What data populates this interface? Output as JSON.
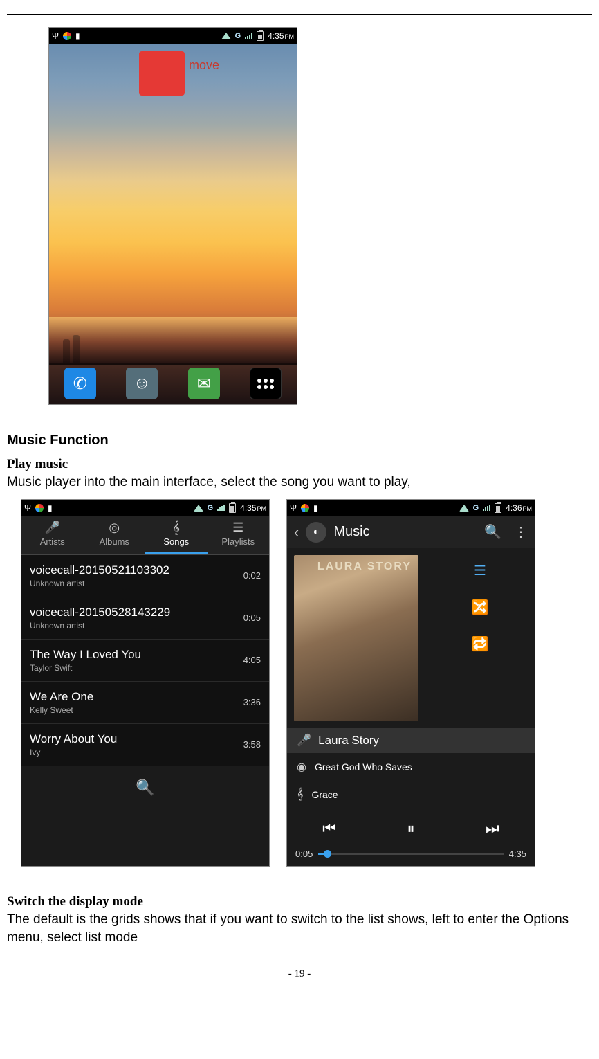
{
  "page_number": "- 19 -",
  "home_screenshot": {
    "statusbar": {
      "time": "4:35",
      "ampm": "PM",
      "network": "G"
    },
    "drag_label": "move",
    "dock": [
      "Phone",
      "Contacts",
      "Messaging",
      "Apps"
    ]
  },
  "section_music_function": "Music Function",
  "section_play_music": "Play music",
  "play_music_body": "Music player into the main interface, select the song you want to play,",
  "music_left": {
    "statusbar": {
      "time": "4:35",
      "ampm": "PM",
      "network": "G"
    },
    "tabs": [
      {
        "label": "Artists",
        "active": false
      },
      {
        "label": "Albums",
        "active": false
      },
      {
        "label": "Songs",
        "active": true
      },
      {
        "label": "Playlists",
        "active": false
      }
    ],
    "songs": [
      {
        "title": "voicecall-20150521103302",
        "artist": "Unknown artist",
        "duration": "0:02"
      },
      {
        "title": "voicecall-20150528143229",
        "artist": "Unknown artist",
        "duration": "0:05"
      },
      {
        "title": "The Way I Loved You",
        "artist": "Taylor Swift",
        "duration": "4:05"
      },
      {
        "title": "We Are One",
        "artist": "Kelly Sweet",
        "duration": "3:36"
      },
      {
        "title": "Worry About You",
        "artist": "Ivy",
        "duration": "3:58"
      }
    ]
  },
  "music_right": {
    "statusbar": {
      "time": "4:36",
      "ampm": "PM",
      "network": "G"
    },
    "header_title": "Music",
    "album_artist": "LAURA STORY",
    "album_subtitle": "Great God Who Saves",
    "artist_row": "Laura Story",
    "list": [
      {
        "icon": "disc",
        "label": "Great God Who Saves"
      },
      {
        "icon": "clef",
        "label": "Grace"
      }
    ],
    "elapsed": "0:05",
    "total": "4:35"
  },
  "section_switch": "Switch the display mode",
  "switch_body": "The default is the grids shows that if you want to switch to the list shows, left to enter the Options menu, select list mode"
}
